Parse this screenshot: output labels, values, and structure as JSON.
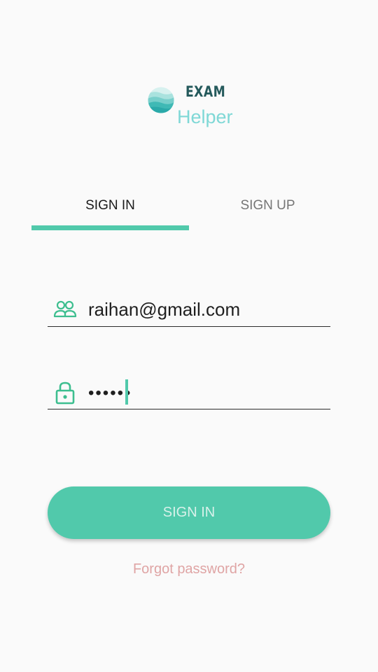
{
  "logo": {
    "title": "EXAM",
    "subtitle": "Helper",
    "icon": "logo-waves-icon"
  },
  "tabs": [
    {
      "label": "SIGN IN",
      "active": true
    },
    {
      "label": "SIGN UP",
      "active": false
    }
  ],
  "form": {
    "email": {
      "icon": "users-icon",
      "value": "raihan@gmail.com"
    },
    "password": {
      "icon": "lock-icon",
      "value": "••••••"
    },
    "submit_label": "SIGN IN",
    "forgot_label": "Forgot password?"
  },
  "colors": {
    "accent": "#51c9ab",
    "background": "#fafafa",
    "forgot_text": "#dfa4a4",
    "logo_dark": "#255a5c",
    "logo_light": "#7fd8d6"
  }
}
